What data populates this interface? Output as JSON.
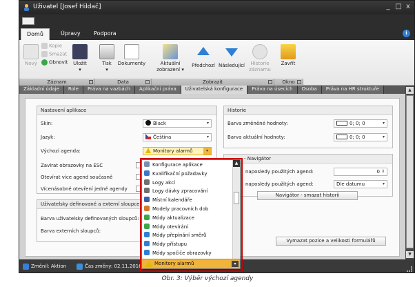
{
  "window": {
    "title": "Uživatel [Josef Hildač]",
    "controls": [
      "_",
      "□",
      "x"
    ]
  },
  "ribbon_tabs": [
    {
      "label": "Domů",
      "active": true
    },
    {
      "label": "Úpravy",
      "active": false
    },
    {
      "label": "Podpora",
      "active": false
    }
  ],
  "help_icon": "i",
  "ribbon": {
    "new_label": "Nový",
    "copy_label": "Kopie",
    "delete_label": "Smazat",
    "refresh_label": "Obnovit",
    "save_label": "Uložit",
    "print_label": "Tisk",
    "documents_label": "Dokumenty",
    "current_view_label": "Aktuální zobrazení",
    "previous_label": "Předchozí",
    "next_label": "Následující",
    "history_label": "Historie záznamu",
    "close_label": "Zavřít",
    "groups": {
      "record": "Záznam",
      "data": "Data",
      "display": "Zobrazit",
      "window": "Okno"
    }
  },
  "content_tabs": [
    {
      "label": "Základní údaje",
      "active": false
    },
    {
      "label": "Role",
      "active": false
    },
    {
      "label": "Práva na vazbách",
      "active": false
    },
    {
      "label": "Aplikační práva",
      "active": false
    },
    {
      "label": "Uživatelská konfigurace",
      "active": true
    },
    {
      "label": "Práva na úsecích",
      "active": false
    },
    {
      "label": "Osoba",
      "active": false
    },
    {
      "label": "Práva na HR struktuře",
      "active": false
    }
  ],
  "settings_group": {
    "title": "Nastavení aplikace",
    "skin_label": "Skin:",
    "skin_value": "Black",
    "language_label": "Jazyk:",
    "language_value": "Čeština",
    "default_agenda_label": "Výchozí agenda:",
    "default_agenda_value": "Monitory alarmů",
    "close_on_esc_label": "Zavírat obrazovky na ESC",
    "open_multiple_label": "Otevírat více agend současně",
    "multiple_same_label": "Vícenásobné otevření jedné agendy"
  },
  "columns_group": {
    "title": "Uživatelsky definované a externí sloupce",
    "user_columns_color_label": "Barva uživatelsky definovaných sloupců:",
    "external_columns_color_label": "Barva externích sloupců:"
  },
  "history_group": {
    "title": "Historie",
    "changed_value_color_label": "Barva změněné hodnoty:",
    "changed_value_color": "0; 0; 0",
    "current_value_color_label": "Barva aktuální hodnoty:",
    "current_value_color": "0; 0; 0"
  },
  "navigator_group": {
    "title": "Navigátor",
    "title_prefix_visible": "- Navigátor",
    "last_used_count_label": "naposledy použitých agend:",
    "last_used_count_value": "0",
    "last_used_sort_label": "naposledy použitých agend:",
    "last_used_sort_value": "Dle datumu",
    "clear_history_button": "Navigátor - smazat historii"
  },
  "reset_layout_button": "Vymazat pozice a velikosti formulářů",
  "dropdown": {
    "items": [
      {
        "label": "Konfigurace aplikace",
        "icon": "gear-icon",
        "color": "#7a8fb0"
      },
      {
        "label": "Kvalifikační požadavky",
        "icon": "person-icon",
        "color": "#3c78c8"
      },
      {
        "label": "Logy akcí",
        "icon": "log-icon",
        "color": "#6f6f6f"
      },
      {
        "label": "Logy dávky zpracování",
        "icon": "log-icon",
        "color": "#6f6f6f"
      },
      {
        "label": "Místní kalendáře",
        "icon": "calendar-icon",
        "color": "#3a5fa8"
      },
      {
        "label": "Modely pracovních dob",
        "icon": "clock-icon",
        "color": "#d07a2a"
      },
      {
        "label": "Módy aktualizace",
        "icon": "refresh-icon",
        "color": "#3aa64a"
      },
      {
        "label": "Módy otevírání",
        "icon": "open-icon",
        "color": "#3aa64a"
      },
      {
        "label": "Módy přepínání směrů",
        "icon": "arrows-icon",
        "color": "#2f7fd6"
      },
      {
        "label": "Módy přístupu",
        "icon": "key-icon",
        "color": "#2f7fd6"
      },
      {
        "label": "Módy spočiče obrazovky",
        "icon": "screen-icon",
        "color": "#2f7fd6"
      }
    ],
    "selected_label": "Monitory alarmů"
  },
  "status": {
    "changed_by_label": "Změnil: Aktion",
    "change_time_label": "Čas změny: 02.11.2016"
  },
  "caption": "Obr.  3: Výběr výchozí agendy",
  "colors": {
    "accent": "#f1b43a",
    "highlight_frame": "#d00000",
    "chrome_dark": "#2d2d2d"
  }
}
